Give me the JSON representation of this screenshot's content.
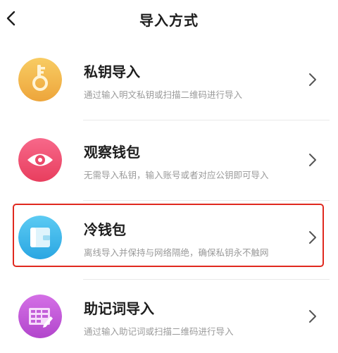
{
  "header": {
    "title": "导入方式"
  },
  "items": [
    {
      "title": "私钥导入",
      "desc": "通过输入明文私钥或扫描二维码进行导入",
      "icon": "key-icon",
      "color": "#f2b349"
    },
    {
      "title": "观察钱包",
      "desc": "无需导入私钥，输入账号或者对应公钥即可导入",
      "icon": "eye-icon",
      "color": "#ef4d6f"
    },
    {
      "title": "冷钱包",
      "desc": "离线导入并保持与网络隔绝，确保私钥永不触网",
      "icon": "wallet-icon",
      "color": "#35b5e9"
    },
    {
      "title": "助记词导入",
      "desc": "通过输入助记词或扫描二维码进行导入",
      "icon": "mnemonic-grid-icon",
      "color": "#c054d6"
    }
  ],
  "colors": {
    "highlight_border": "#e0291f",
    "title_text": "#1e1e1e",
    "desc_text": "#9a9a9a"
  }
}
